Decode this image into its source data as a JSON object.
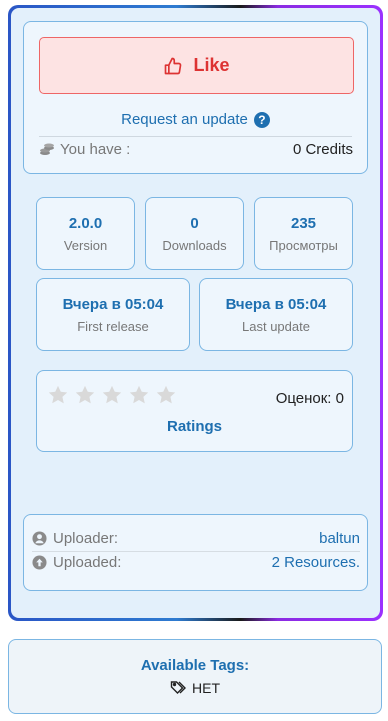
{
  "like": {
    "label": "Like",
    "icon": "thumbs-up-icon"
  },
  "request_update": {
    "label": "Request an update",
    "icon": "question-circle-icon"
  },
  "credits": {
    "label": "You have :",
    "value": "0 Credits",
    "icon": "coins-icon"
  },
  "stats": [
    {
      "value": "2.0.0",
      "label": "Version"
    },
    {
      "value": "0",
      "label": "Downloads"
    },
    {
      "value": "235",
      "label": "Просмотры"
    },
    {
      "value": "Вчера в 05:04",
      "label": "First release"
    },
    {
      "value": "Вчера в 05:04",
      "label": "Last update"
    }
  ],
  "rating": {
    "stars_filled": 0,
    "stars_total": 5,
    "count_label": "Оценок: 0",
    "title": "Ratings"
  },
  "uploader": {
    "uploader_label": "Uploader:",
    "uploader_value": "baltun",
    "uploaded_label": "Uploaded:",
    "uploaded_value": "2 Resources."
  },
  "tags": {
    "title": "Available Tags:",
    "items": [
      "НЕТ"
    ]
  },
  "colors": {
    "accent": "#1e6fb0",
    "like_red": "#dd3333",
    "panel_bg": "#e3f0fb"
  }
}
